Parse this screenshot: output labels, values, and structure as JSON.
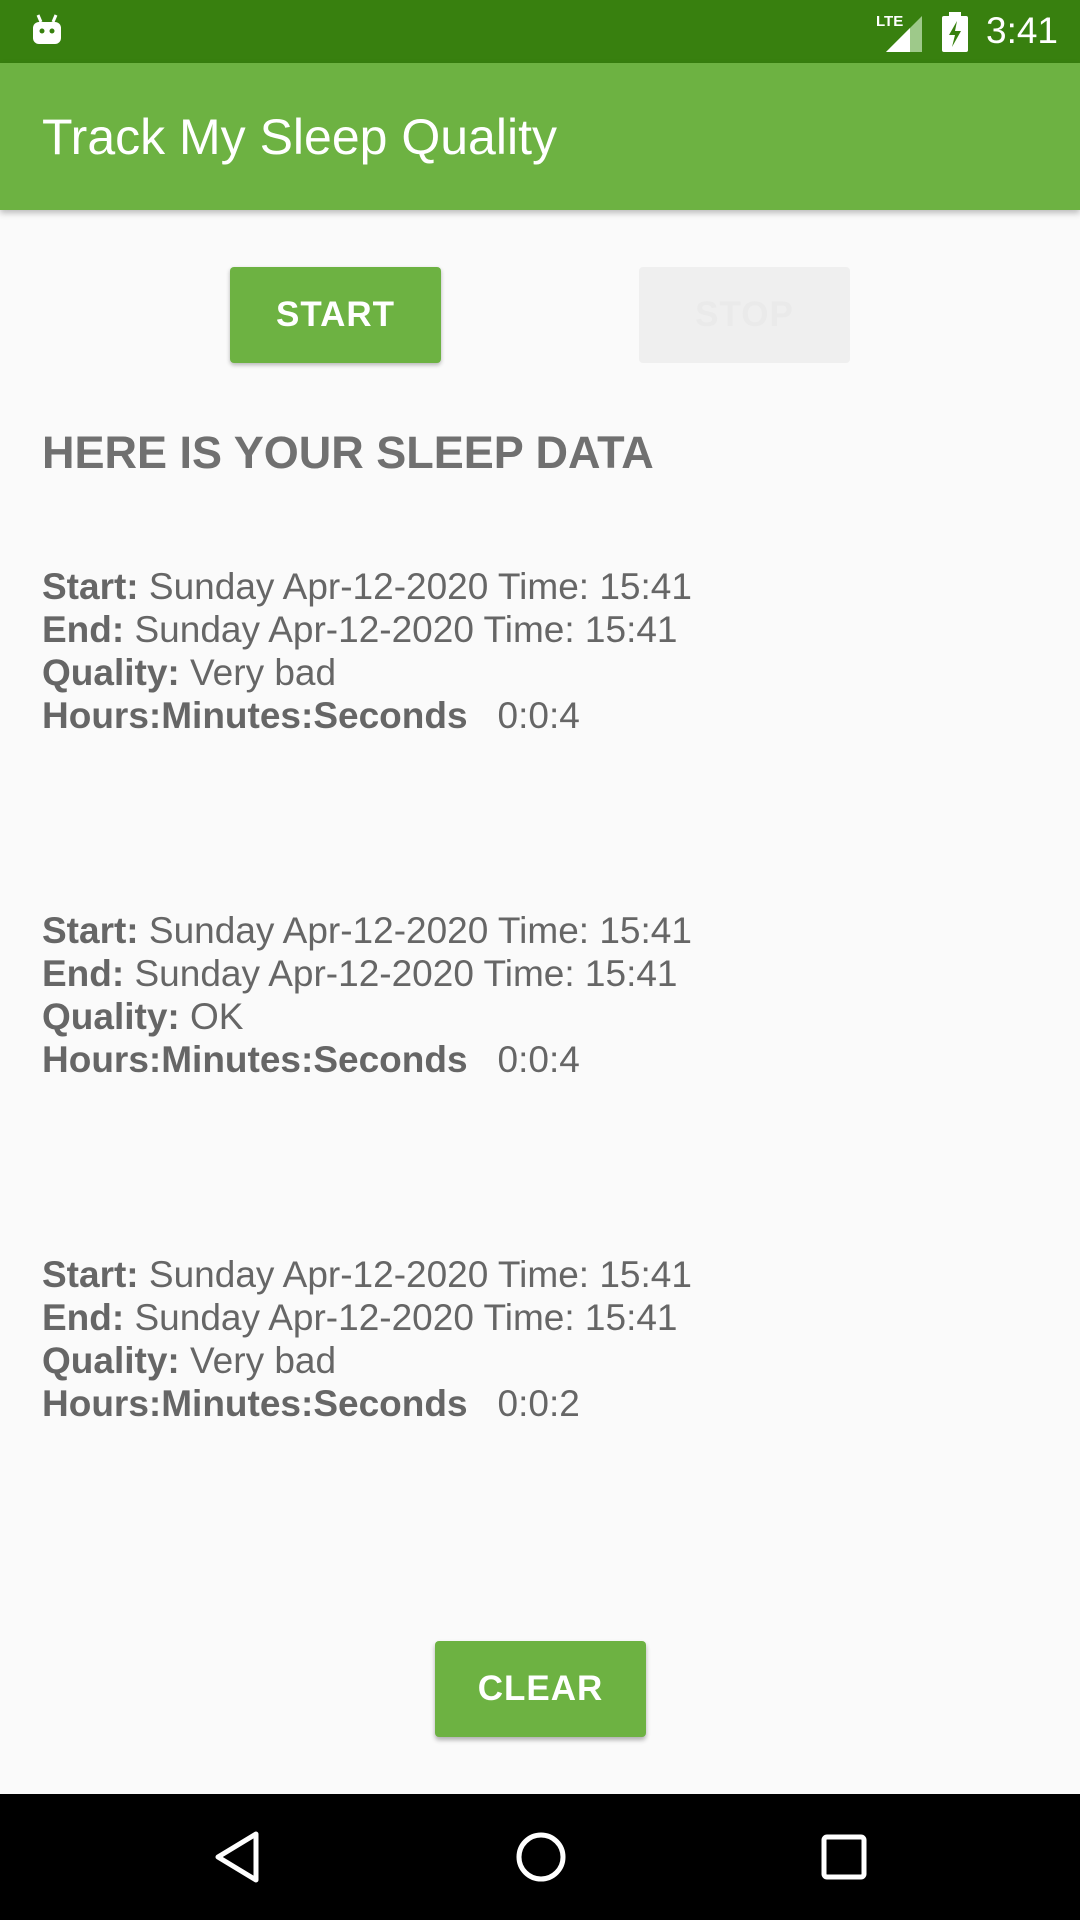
{
  "status_bar": {
    "network": "LTE",
    "time": "3:41"
  },
  "app_bar": {
    "title": "Track My Sleep Quality"
  },
  "buttons": {
    "start": "START",
    "stop": "STOP",
    "clear": "CLEAR"
  },
  "heading": "HERE IS YOUR SLEEP DATA",
  "labels": {
    "start": "Start:",
    "end": "End:",
    "quality": "Quality:",
    "duration": "Hours:Minutes:Seconds"
  },
  "records": [
    {
      "start": "Sunday Apr-12-2020 Time: 15:41",
      "end": "Sunday Apr-12-2020 Time: 15:41",
      "quality": "Very bad",
      "duration": "0:0:4"
    },
    {
      "start": "Sunday Apr-12-2020 Time: 15:41",
      "end": "Sunday Apr-12-2020 Time: 15:41",
      "quality": "OK",
      "duration": "0:0:4"
    },
    {
      "start": "Sunday Apr-12-2020 Time: 15:41",
      "end": "Sunday Apr-12-2020 Time: 15:41",
      "quality": "Very bad",
      "duration": "0:0:2"
    }
  ],
  "colors": {
    "status_bar": "#38800f",
    "primary": "#6db242",
    "text": "#666666",
    "heading": "#707070",
    "background": "#fafafa"
  },
  "icons": {
    "status": [
      "android-icon",
      "lte-signal-icon",
      "battery-charging-icon"
    ],
    "nav": [
      "back-icon",
      "home-icon",
      "recents-icon"
    ]
  }
}
